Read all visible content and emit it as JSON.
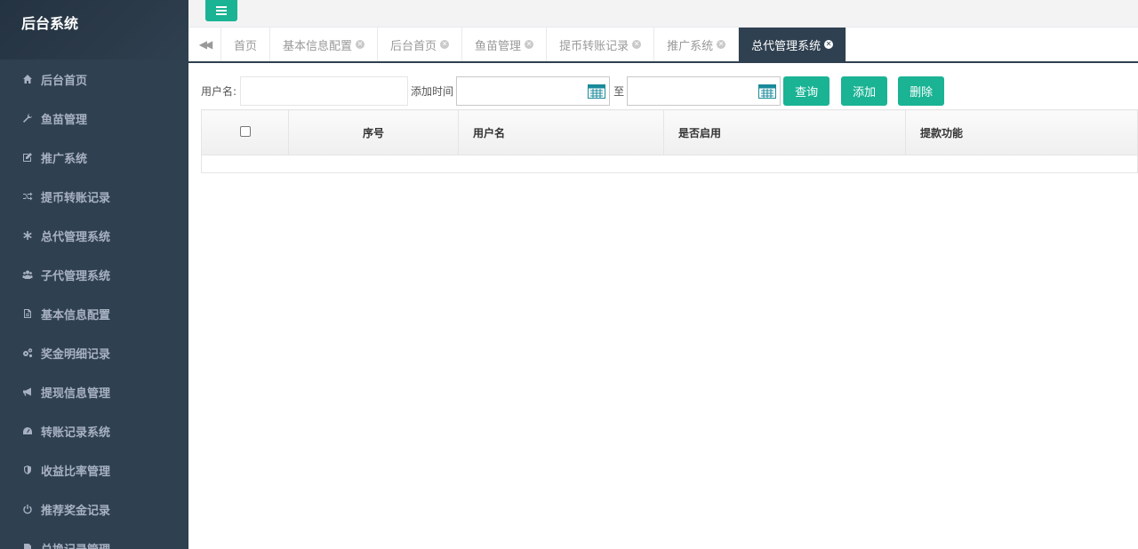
{
  "app_title": "后台系统",
  "sidebar": {
    "items": [
      {
        "label": "后台首页",
        "icon": "home-icon"
      },
      {
        "label": "鱼苗管理",
        "icon": "wrench-icon"
      },
      {
        "label": "推广系统",
        "icon": "edit-icon"
      },
      {
        "label": "提币转账记录",
        "icon": "shuffle-icon"
      },
      {
        "label": "总代管理系统",
        "icon": "asterisk-icon"
      },
      {
        "label": "子代管理系统",
        "icon": "users-icon"
      },
      {
        "label": "基本信息配置",
        "icon": "file-icon"
      },
      {
        "label": "奖金明细记录",
        "icon": "cogs-icon"
      },
      {
        "label": "提现信息管理",
        "icon": "bullhorn-icon"
      },
      {
        "label": "转账记录系统",
        "icon": "dashboard-icon"
      },
      {
        "label": "收益比率管理",
        "icon": "shield-icon"
      },
      {
        "label": "推荐奖金记录",
        "icon": "power-icon"
      },
      {
        "label": "兑换记录管理",
        "icon": "file-icon"
      }
    ]
  },
  "tabs": [
    {
      "label": "首页",
      "closable": false,
      "active": false
    },
    {
      "label": "基本信息配置",
      "closable": true,
      "active": false
    },
    {
      "label": "后台首页",
      "closable": true,
      "active": false
    },
    {
      "label": "鱼苗管理",
      "closable": true,
      "active": false
    },
    {
      "label": "提币转账记录",
      "closable": true,
      "active": false
    },
    {
      "label": "推广系统",
      "closable": true,
      "active": false
    },
    {
      "label": "总代管理系统",
      "closable": true,
      "active": true
    }
  ],
  "filter": {
    "username_label": "用户名:",
    "username_value": "",
    "time_label": "添加时间",
    "date_from": "",
    "to_label": "至",
    "date_to": "",
    "search_label": "查询",
    "add_label": "添加",
    "delete_label": "删除"
  },
  "table": {
    "columns": [
      "序号",
      "用户名",
      "是否启用",
      "提款功能"
    ],
    "rows": []
  },
  "colors": {
    "sidebar_bg": "#2f4050",
    "accent": "#1ab394"
  }
}
